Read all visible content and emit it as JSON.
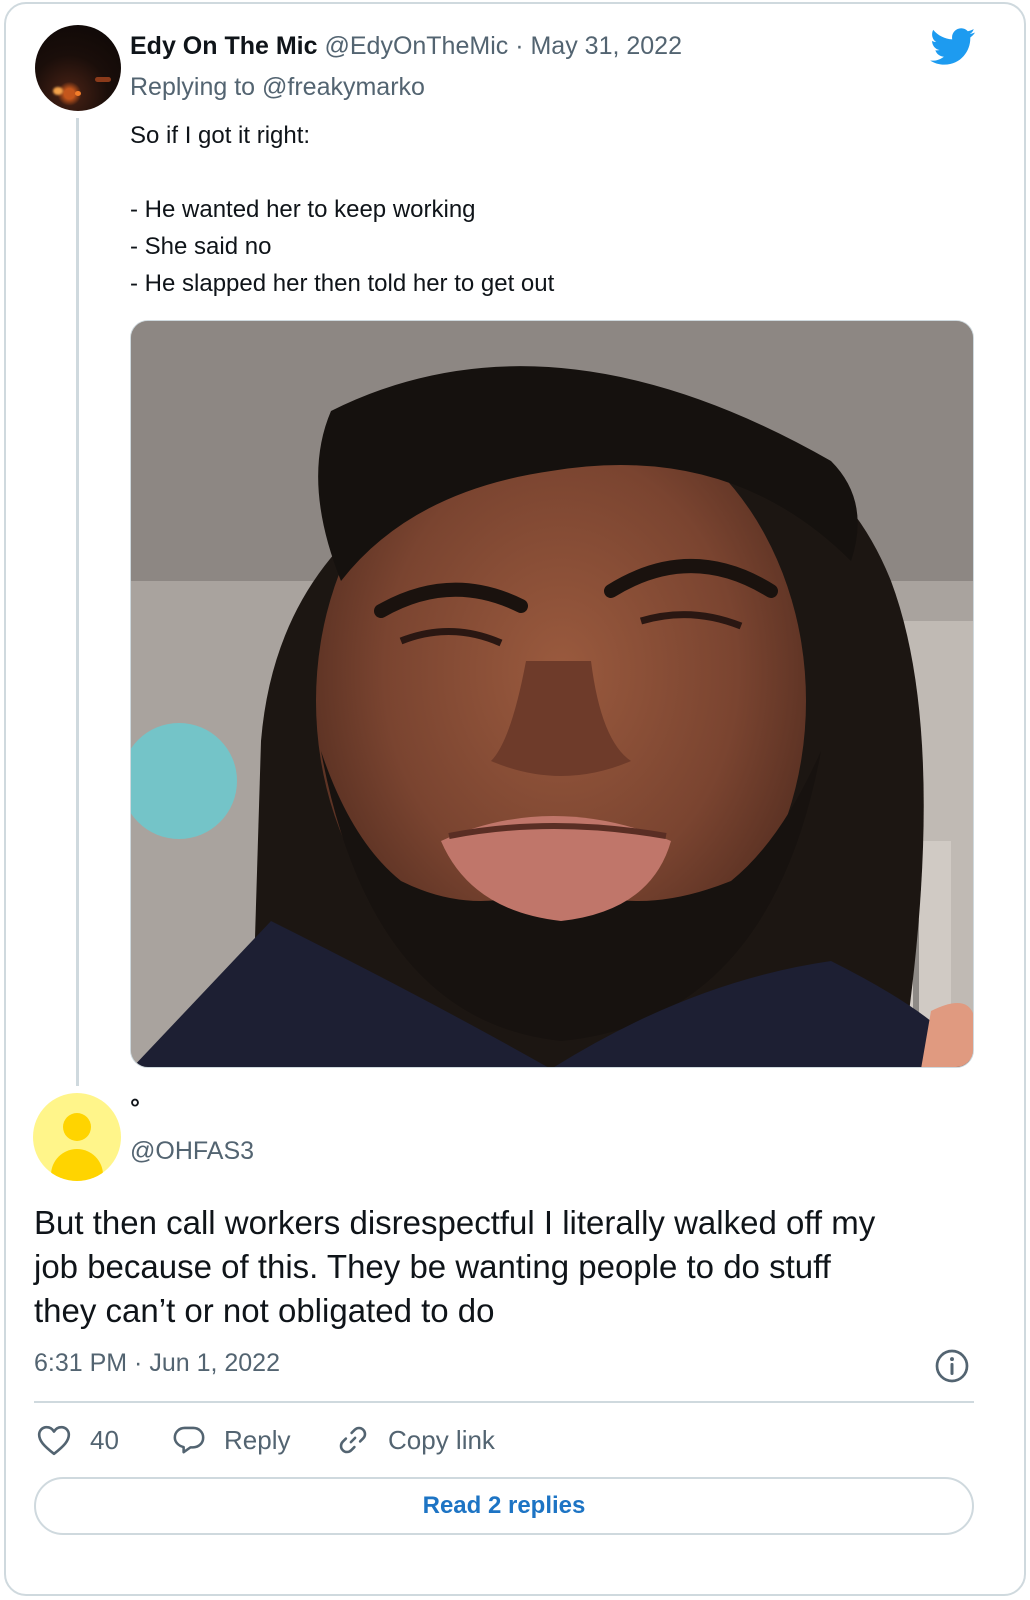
{
  "parent_tweet": {
    "display_name": "Edy On The Mic",
    "handle": "@EdyOnTheMic",
    "separator": "·",
    "date": "May 31, 2022",
    "replying_to": "Replying to @freakymarko",
    "text_lines": [
      "So if I got it right:",
      "",
      "- He wanted her to keep working",
      "- She said no",
      "- He slapped her then told her to get out"
    ],
    "icon": "twitter-bird-icon",
    "media": "photo-of-man-squinting"
  },
  "reply_tweet": {
    "display_name": "°",
    "handle": "@OHFAS3",
    "text_lines": [
      "But then call workers disrespectful I literally walked off my",
      "job because of this. They be wanting people to do stuff",
      "they can’t or not obligated to do"
    ],
    "timestamp": "6:31 PM · Jun 1, 2022",
    "avatar_color": "#ffd400"
  },
  "actions": {
    "like_count": "40",
    "reply_label": "Reply",
    "copy_label": "Copy link"
  },
  "read_replies_label": "Read 2 replies",
  "colors": {
    "twitter_blue": "#1d9bf0",
    "link_blue": "#1d74c4",
    "secondary_text": "#536471",
    "border": "#cfd9de"
  }
}
